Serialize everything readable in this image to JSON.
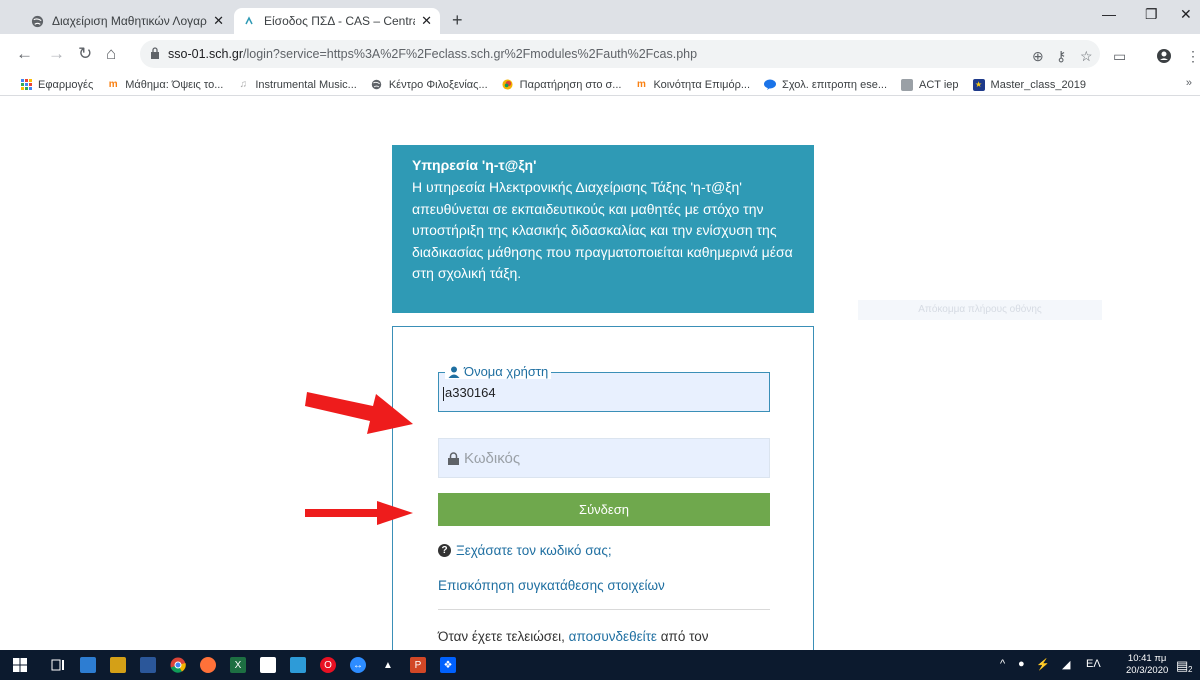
{
  "browser": {
    "tabs": [
      {
        "title": "Διαχείριση Μαθητικών Λογαρια",
        "active": false
      },
      {
        "title": "Είσοδος ΠΣΔ - CAS – Central Aut",
        "active": true
      }
    ],
    "url": {
      "host": "sso-01.sch.gr",
      "path": "/login?service=https%3A%2F%2Feclass.sch.gr%2Fmodules%2Fauth%2Fcas.php"
    },
    "bookmarks": [
      {
        "label": "Εφαρμογές",
        "icon": "apps-grid-icon"
      },
      {
        "label": "Μάθημα: Όψεις το...",
        "icon": "moodle-icon"
      },
      {
        "label": "Instrumental Music...",
        "icon": "music-icon"
      },
      {
        "label": "Κέντρο Φιλοξενίας...",
        "icon": "globe-icon"
      },
      {
        "label": "Παρατήρηση στο σ...",
        "icon": "colorful-circle-icon"
      },
      {
        "label": "Κοινότητα Επιμόρ...",
        "icon": "moodle-icon"
      },
      {
        "label": "Σχολ. επιτροπη ese...",
        "icon": "chat-icon"
      },
      {
        "label": "ACT iep",
        "icon": "doc-icon"
      },
      {
        "label": "Master_class_2019",
        "icon": "eu-flag-icon"
      }
    ],
    "bookmarks_more": "»"
  },
  "page": {
    "info": {
      "title": "Υπηρεσία 'η-τ@ξη'",
      "body": "Η υπηρεσία Ηλεκτρονικής Διαχείρισης Τάξης 'η-τ@ξη' απευθύνεται σε εκπαιδευτικούς και μαθητές με στόχο την υποστήριξη της κλασικής διδασκαλίας και την ενίσχυση της διαδικασίας μάθησης που πραγματοποιείται καθημερινά μέσα στη σχολική τάξη."
    },
    "ghost_banner": "Απόκομμα πλήρους οθόνης",
    "login": {
      "username_legend": "Όνομα χρήστη",
      "username_value": "a330164",
      "password_placeholder": "Κωδικός",
      "submit_label": "Σύνδεση",
      "forgot_label": "Ξεχάσατε τον κωδικό σας;",
      "consent_label": "Επισκόπηση συγκατάθεσης στοιχείων",
      "logout_prefix": "Όταν έχετε τελειώσει, ",
      "logout_link": "αποσυνδεθείτε",
      "logout_suffix": " από τον"
    }
  },
  "taskbar": {
    "language": "ΕΛ",
    "time": "10:41 πμ",
    "date": "20/3/2020",
    "notification_count": "2"
  },
  "colors": {
    "info_bg": "#2f9ab5",
    "login_border": "#3a8fb7",
    "submit_bg": "#6fa84d",
    "link": "#1f6fa1",
    "arrow": "#ee1c1c"
  }
}
